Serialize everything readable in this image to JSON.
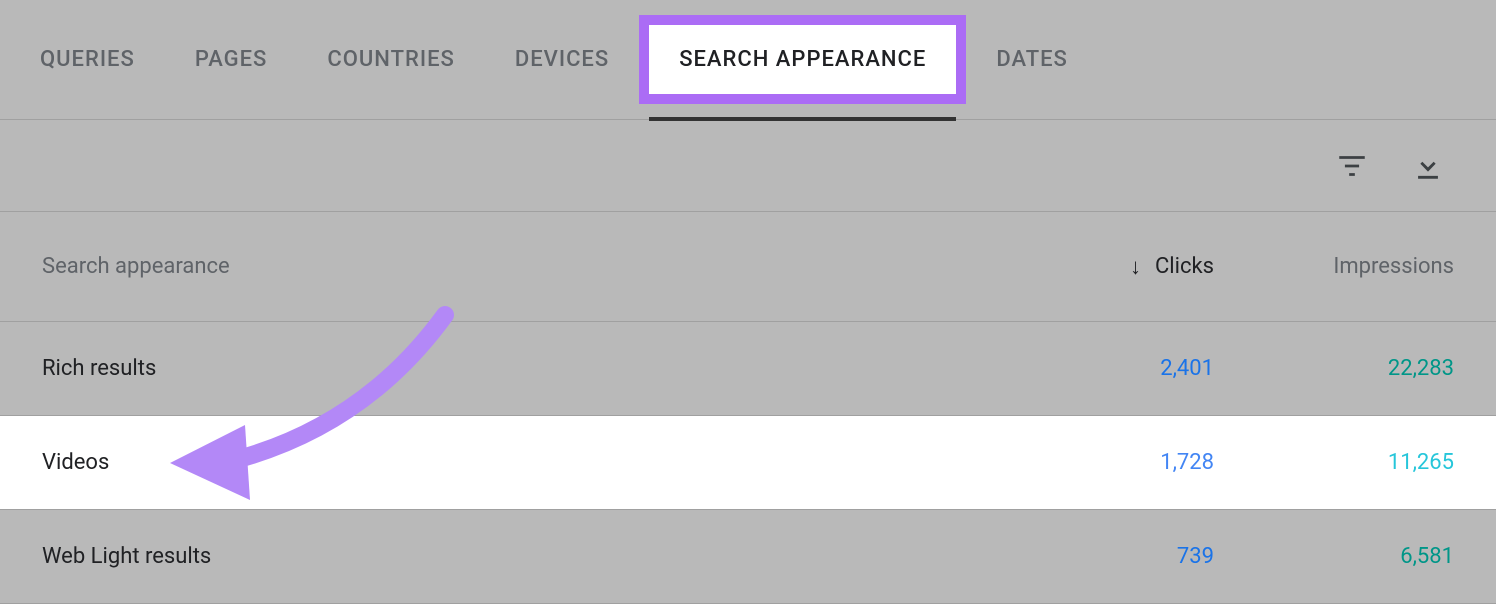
{
  "tabs": {
    "queries": "QUERIES",
    "pages": "PAGES",
    "countries": "COUNTRIES",
    "devices": "DEVICES",
    "search_appearance": "SEARCH APPEARANCE",
    "dates": "DATES"
  },
  "table": {
    "header_name": "Search appearance",
    "header_clicks": "Clicks",
    "header_impressions": "Impressions"
  },
  "rows": [
    {
      "name": "Rich results",
      "clicks": "2,401",
      "impressions": "22,283"
    },
    {
      "name": "Videos",
      "clicks": "1,728",
      "impressions": "11,265"
    },
    {
      "name": "Web Light results",
      "clicks": "739",
      "impressions": "6,581"
    }
  ]
}
